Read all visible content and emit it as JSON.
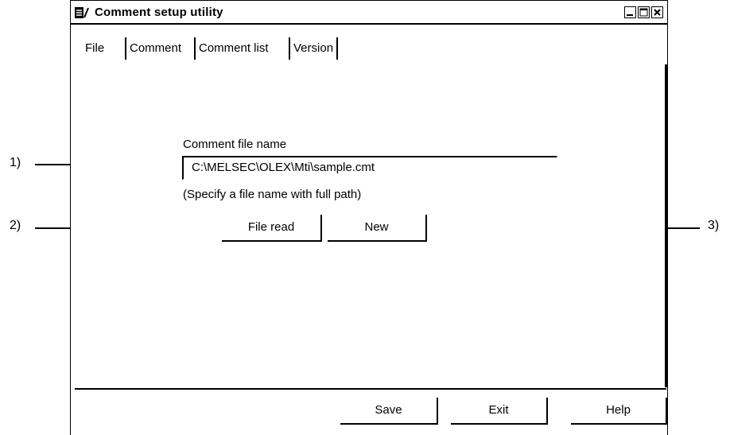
{
  "window": {
    "title": "Comment setup utility",
    "minimize_icon": "minimize-icon",
    "maximize_icon": "maximize-icon",
    "close_icon": "close-icon"
  },
  "tabs": [
    {
      "label": "File",
      "active": true
    },
    {
      "label": "Comment"
    },
    {
      "label": "Comment list"
    },
    {
      "label": "Version"
    }
  ],
  "file_panel": {
    "field_label": "Comment file name",
    "field_value": "C:\\MELSEC\\OLEX\\Mti\\sample.cmt",
    "hint": "(Specify a file name with full path)",
    "file_read_label": "File read",
    "new_label": "New"
  },
  "footer": {
    "save_label": "Save",
    "exit_label": "Exit",
    "help_label": "Help"
  },
  "annotations": {
    "a1": "1)",
    "a2": "2)",
    "a3": "3)"
  }
}
